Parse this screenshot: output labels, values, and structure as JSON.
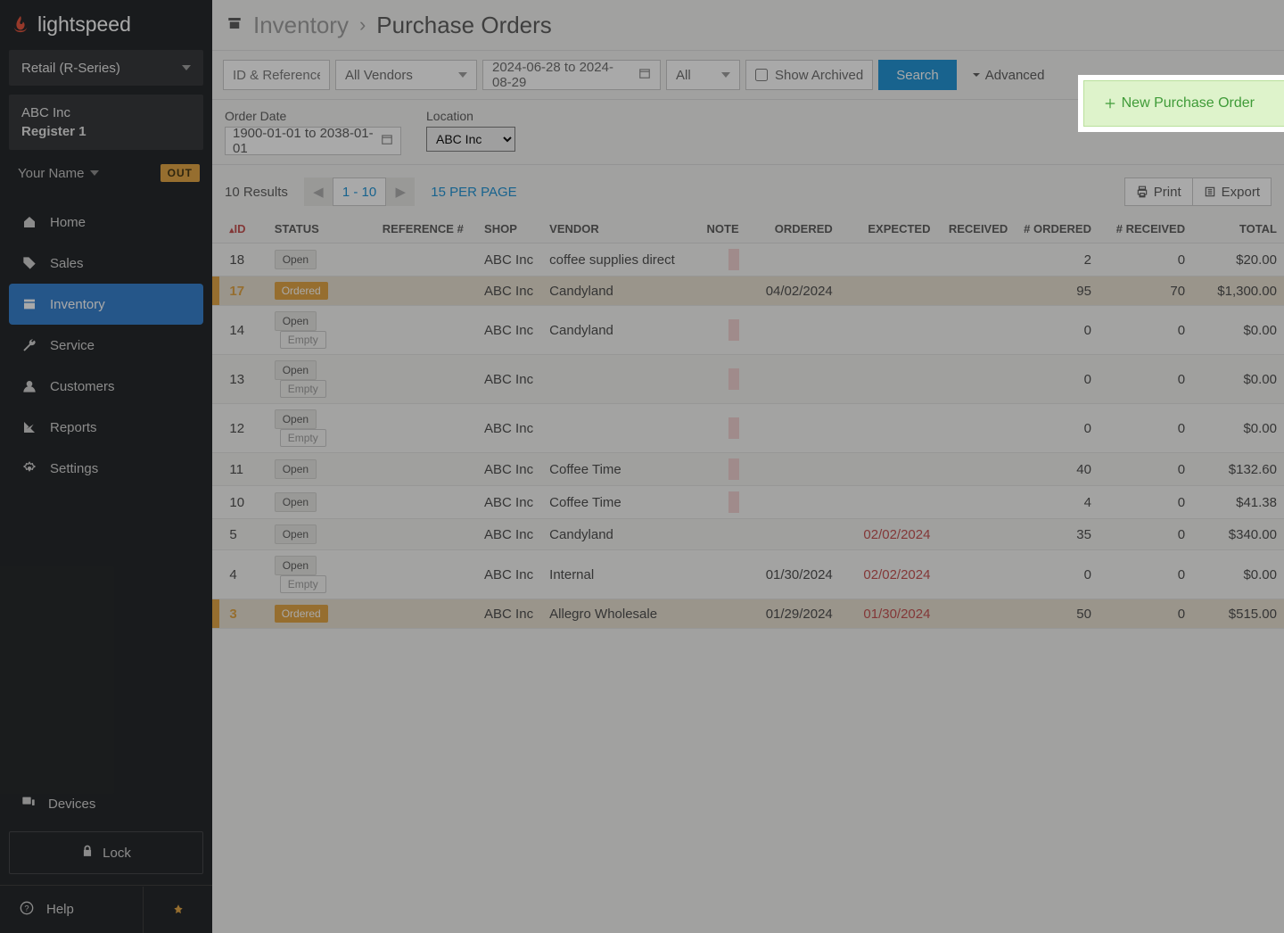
{
  "brand": "lightspeed",
  "sidebar": {
    "retail_select": "Retail (R-Series)",
    "company": "ABC Inc",
    "register": "Register 1",
    "user_name": "Your Name",
    "out_badge": "OUT",
    "nav": {
      "home": "Home",
      "sales": "Sales",
      "inventory": "Inventory",
      "service": "Service",
      "customers": "Customers",
      "reports": "Reports",
      "settings": "Settings"
    },
    "devices": "Devices",
    "lock": "Lock",
    "help": "Help"
  },
  "breadcrumb": {
    "parent": "Inventory",
    "page": "Purchase Orders"
  },
  "filters": {
    "id_ref_placeholder": "ID & Reference #",
    "vendors": "All Vendors",
    "date_range": "2024-06-28 to 2024-08-29",
    "status": "All",
    "show_archived": "Show Archived",
    "search": "Search",
    "advanced": "Advanced"
  },
  "secondary": {
    "order_date_label": "Order Date",
    "order_date_value": "1900-01-01 to 2038-01-01",
    "location_label": "Location",
    "location_value": "ABC Inc"
  },
  "results": {
    "count_text": "10 Results",
    "range": "1 - 10",
    "per_page": "15 PER PAGE",
    "print": "Print",
    "export": "Export"
  },
  "new_po": "New Purchase Order",
  "table": {
    "headers": {
      "id": "ID",
      "status": "STATUS",
      "reference": "REFERENCE #",
      "shop": "SHOP",
      "vendor": "VENDOR",
      "note": "NOTE",
      "ordered": "ORDERED",
      "expected": "EXPECTED",
      "received": "RECEIVED",
      "num_ordered": "# ORDERED",
      "num_received": "# RECEIVED",
      "total": "TOTAL"
    },
    "rows": [
      {
        "id": "18",
        "status": "Open",
        "empty": false,
        "shop": "ABC Inc",
        "vendor": "coffee supplies direct",
        "note": true,
        "ordered": "",
        "expected": "",
        "expected_late": false,
        "received": "",
        "num_ordered": "2",
        "num_received": "0",
        "total": "$20.00",
        "highlight": false
      },
      {
        "id": "17",
        "status": "Ordered",
        "empty": false,
        "shop": "ABC Inc",
        "vendor": "Candyland",
        "note": false,
        "ordered": "04/02/2024",
        "expected": "",
        "expected_late": false,
        "received": "",
        "num_ordered": "95",
        "num_received": "70",
        "total": "$1,300.00",
        "highlight": true
      },
      {
        "id": "14",
        "status": "Open",
        "empty": true,
        "shop": "ABC Inc",
        "vendor": "Candyland",
        "note": true,
        "ordered": "",
        "expected": "",
        "expected_late": false,
        "received": "",
        "num_ordered": "0",
        "num_received": "0",
        "total": "$0.00",
        "highlight": false
      },
      {
        "id": "13",
        "status": "Open",
        "empty": true,
        "shop": "ABC Inc",
        "vendor": "",
        "note": true,
        "ordered": "",
        "expected": "",
        "expected_late": false,
        "received": "",
        "num_ordered": "0",
        "num_received": "0",
        "total": "$0.00",
        "highlight": false
      },
      {
        "id": "12",
        "status": "Open",
        "empty": true,
        "shop": "ABC Inc",
        "vendor": "",
        "note": true,
        "ordered": "",
        "expected": "",
        "expected_late": false,
        "received": "",
        "num_ordered": "0",
        "num_received": "0",
        "total": "$0.00",
        "highlight": false
      },
      {
        "id": "11",
        "status": "Open",
        "empty": false,
        "shop": "ABC Inc",
        "vendor": "Coffee Time",
        "note": true,
        "ordered": "",
        "expected": "",
        "expected_late": false,
        "received": "",
        "num_ordered": "40",
        "num_received": "0",
        "total": "$132.60",
        "highlight": false
      },
      {
        "id": "10",
        "status": "Open",
        "empty": false,
        "shop": "ABC Inc",
        "vendor": "Coffee Time",
        "note": true,
        "ordered": "",
        "expected": "",
        "expected_late": false,
        "received": "",
        "num_ordered": "4",
        "num_received": "0",
        "total": "$41.38",
        "highlight": false
      },
      {
        "id": "5",
        "status": "Open",
        "empty": false,
        "shop": "ABC Inc",
        "vendor": "Candyland",
        "note": false,
        "ordered": "",
        "expected": "02/02/2024",
        "expected_late": true,
        "received": "",
        "num_ordered": "35",
        "num_received": "0",
        "total": "$340.00",
        "highlight": false
      },
      {
        "id": "4",
        "status": "Open",
        "empty": true,
        "shop": "ABC Inc",
        "vendor": "Internal",
        "note": false,
        "ordered": "01/30/2024",
        "expected": "02/02/2024",
        "expected_late": true,
        "received": "",
        "num_ordered": "0",
        "num_received": "0",
        "total": "$0.00",
        "highlight": false
      },
      {
        "id": "3",
        "status": "Ordered",
        "empty": false,
        "shop": "ABC Inc",
        "vendor": "Allegro Wholesale",
        "note": false,
        "ordered": "01/29/2024",
        "expected": "01/30/2024",
        "expected_late": true,
        "received": "",
        "num_ordered": "50",
        "num_received": "0",
        "total": "$515.00",
        "highlight": true
      }
    ],
    "empty_label": "Empty"
  }
}
